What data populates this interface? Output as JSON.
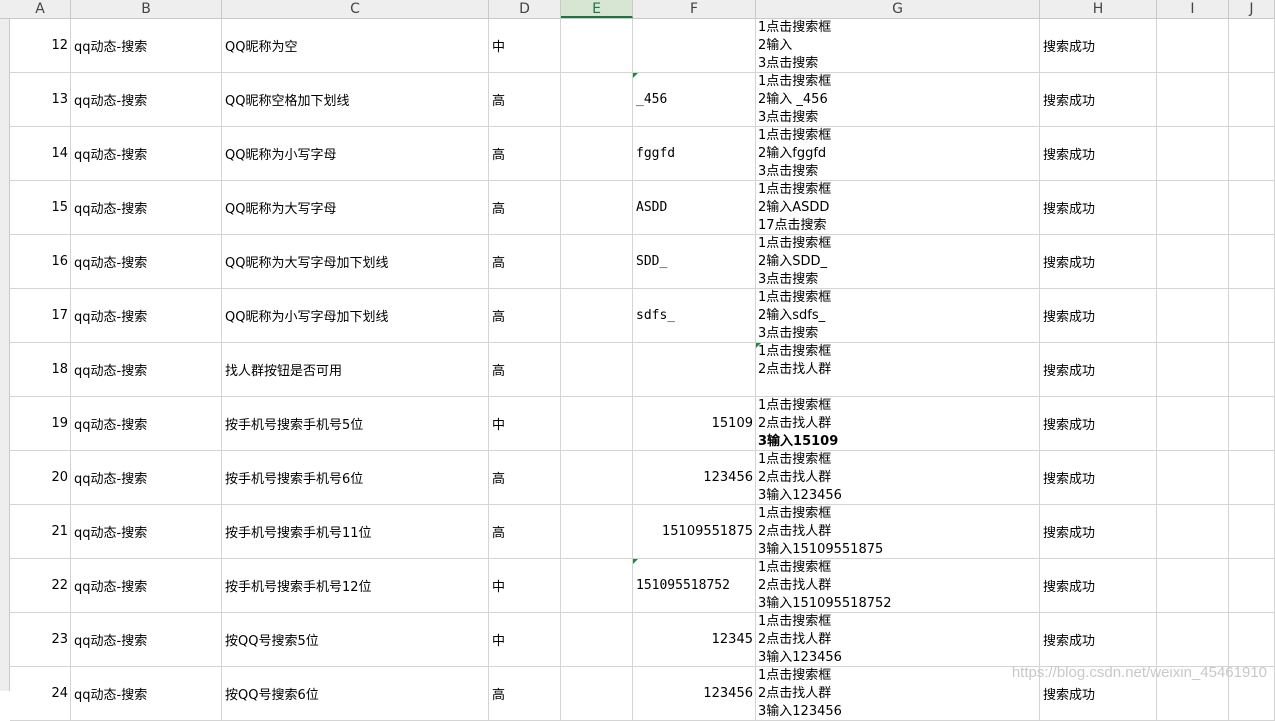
{
  "columns": [
    "A",
    "B",
    "C",
    "D",
    "E",
    "F",
    "G",
    "H",
    "I",
    "J"
  ],
  "selected_column": "E",
  "rows": [
    {
      "num": "12",
      "module": "qq动态-搜索",
      "case": "QQ昵称为空",
      "priority": "中",
      "input": "",
      "steps": [
        "1点击搜索框",
        "2输入",
        "3点击搜索"
      ],
      "result": "搜索成功"
    },
    {
      "num": "13",
      "module": "qq动态-搜索",
      "case": "QQ昵称空格加下划线",
      "priority": "高",
      "input": " _456",
      "steps": [
        "1点击搜索框",
        "2输入 _456",
        "3点击搜索"
      ],
      "result": "搜索成功"
    },
    {
      "num": "14",
      "module": "qq动态-搜索",
      "case": "QQ昵称为小写字母",
      "priority": "高",
      "input": "fggfd",
      "steps": [
        "1点击搜索框",
        "2输入fggfd",
        "3点击搜索"
      ],
      "result": "搜索成功"
    },
    {
      "num": "15",
      "module": "qq动态-搜索",
      "case": "QQ昵称为大写字母",
      "priority": "高",
      "input": "ASDD",
      "steps": [
        "1点击搜索框",
        "2输入ASDD",
        "17点击搜索"
      ],
      "result": "搜索成功"
    },
    {
      "num": "16",
      "module": "qq动态-搜索",
      "case": "QQ昵称为大写字母加下划线",
      "priority": "高",
      "input": "SDD_",
      "steps": [
        "1点击搜索框",
        "2输入SDD_",
        "3点击搜索"
      ],
      "result": "搜索成功"
    },
    {
      "num": "17",
      "module": "qq动态-搜索",
      "case": "QQ昵称为小写字母加下划线",
      "priority": "高",
      "input": "sdfs_",
      "steps": [
        "1点击搜索框",
        "2输入sdfs_",
        "3点击搜索"
      ],
      "result": "搜索成功"
    },
    {
      "num": "18",
      "module": "qq动态-搜索",
      "case": "找人群按钮是否可用",
      "priority": "高",
      "input": "",
      "steps": [
        "1点击搜索框",
        "2点击找人群"
      ],
      "result": "搜索成功"
    },
    {
      "num": "19",
      "module": "qq动态-搜索",
      "case": "按手机号搜索手机号5位",
      "priority": "中",
      "input": "15109",
      "steps": [
        "1点击搜索框",
        "2点击找人群",
        "3输入15109"
      ],
      "result": "搜索成功"
    },
    {
      "num": "20",
      "module": "qq动态-搜索",
      "case": "按手机号搜索手机号6位",
      "priority": "高",
      "input": "123456",
      "steps": [
        "1点击搜索框",
        "2点击找人群",
        "3输入123456"
      ],
      "result": "搜索成功"
    },
    {
      "num": "21",
      "module": "qq动态-搜索",
      "case": "按手机号搜索手机号11位",
      "priority": "高",
      "input": "15109551875",
      "steps": [
        "1点击搜索框",
        "2点击找人群",
        "3输入15109551875"
      ],
      "result": "搜索成功"
    },
    {
      "num": "22",
      "module": "qq动态-搜索",
      "case": "按手机号搜索手机号12位",
      "priority": "中",
      "input": "151095518752",
      "steps": [
        "1点击搜索框",
        "2点击找人群",
        "3输入151095518752"
      ],
      "result": "搜索成功"
    },
    {
      "num": "23",
      "module": "qq动态-搜索",
      "case": "按QQ号搜索5位",
      "priority": "中",
      "input": "12345",
      "steps": [
        "1点击搜索框",
        "2点击找人群",
        "3输入123456"
      ],
      "result": "搜索成功"
    },
    {
      "num": "24",
      "module": "qq动态-搜索",
      "case": "按QQ号搜索6位",
      "priority": "高",
      "input": "123456",
      "steps": [
        "1点击搜索框",
        "2点击找人群",
        "3输入123456"
      ],
      "result": "搜索成功"
    }
  ],
  "watermark": "https://blog.csdn.net/weixin_45461910"
}
